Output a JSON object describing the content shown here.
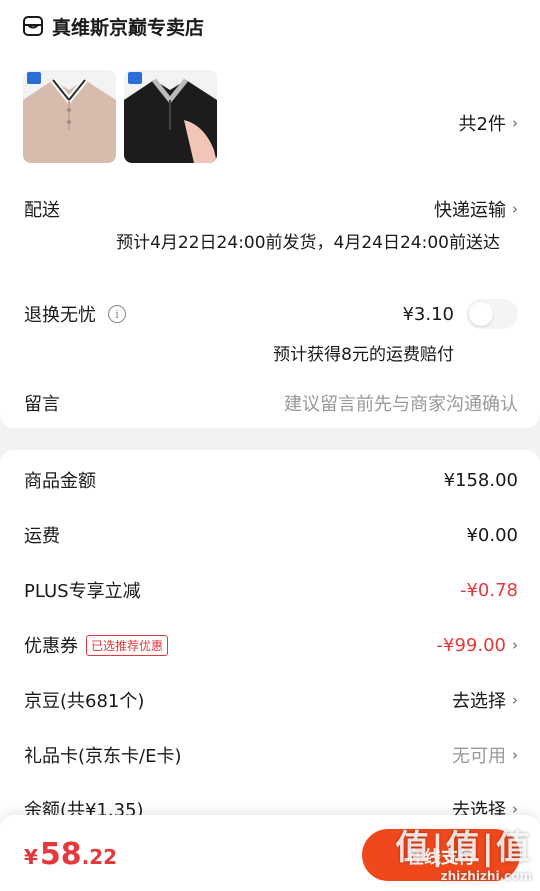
{
  "store": {
    "name": "真维斯京巅专卖店",
    "icon": "store-icon"
  },
  "items": {
    "count_label": "共2件"
  },
  "delivery": {
    "label": "配送",
    "method": "快递运输",
    "eta": "预计4月22日24:00前发货，4月24日24:00前送达"
  },
  "return_insurance": {
    "label": "退换无忧",
    "price": "¥3.10",
    "compensation": "预计获得8元的运费赔付",
    "enabled": false
  },
  "message": {
    "label": "留言",
    "placeholder": "建议留言前先与商家沟通确认"
  },
  "summary": {
    "goods_label": "商品金额",
    "goods_value": "¥158.00",
    "shipping_label": "运费",
    "shipping_value": "¥0.00",
    "plus_label": "PLUS专享立减",
    "plus_value": "-¥0.78",
    "coupon_label": "优惠券",
    "coupon_badge": "已选推荐优惠",
    "coupon_value": "-¥99.00",
    "jingdou_label": "京豆(共681个)",
    "jingdou_value": "去选择",
    "giftcard_label": "礼品卡(京东卡/E卡)",
    "giftcard_value": "无可用",
    "balance_label": "余额(共¥1.35)",
    "balance_value": "去选择"
  },
  "footer": {
    "currency": "¥",
    "total_int": "58",
    "total_dec": ".22",
    "pay_label": "在线支付"
  },
  "watermark": {
    "big": "值|值|值",
    "small": "zhizhizhi.com"
  },
  "colors": {
    "accent": "#e4393c",
    "pay_button": "#f0481c"
  }
}
